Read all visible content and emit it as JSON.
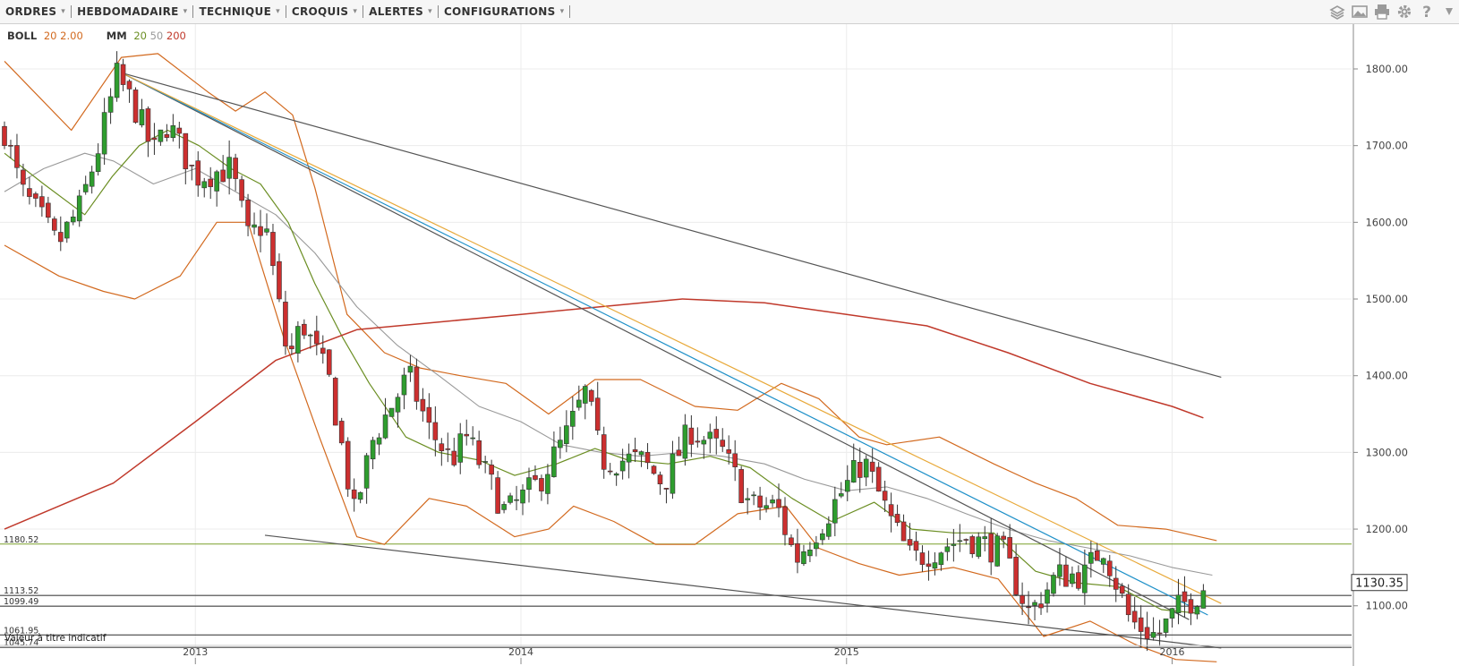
{
  "toolbar": {
    "menus": [
      {
        "label": "ORDRES"
      },
      {
        "label": "HEBDOMADAIRE"
      },
      {
        "label": "TECHNIQUE"
      },
      {
        "label": "CROQUIS"
      },
      {
        "label": "ALERTES"
      },
      {
        "label": "CONFIGURATIONS"
      }
    ],
    "tools": [
      "layers-icon",
      "image-icon",
      "print-icon",
      "gear-icon",
      "help-icon",
      "more-icon"
    ]
  },
  "legend": {
    "boll": {
      "name": "BOLL",
      "p1": "20",
      "p2": "2.00",
      "color": "#d2691e"
    },
    "mm": {
      "name": "MM",
      "p1": "20",
      "p2": "50",
      "p3": "200",
      "c1": "#6b8e23",
      "c2": "#999999",
      "c3": "#c0392b"
    }
  },
  "price_label": "1130.35",
  "footnote": "Valeur à titre indicatif",
  "level_lines": [
    {
      "value": 1180.52,
      "label": "1180.52",
      "color": "#7aa02a"
    },
    {
      "value": 1113.52,
      "label": "1113.52",
      "color": "#444444"
    },
    {
      "value": 1099.49,
      "label": "1099.49",
      "color": "#444444"
    },
    {
      "value": 1061.95,
      "label": "1061.95",
      "color": "#444444"
    },
    {
      "value": 1045.74,
      "label": "1045.74",
      "color": "#444444"
    }
  ],
  "chart_data": {
    "type": "candlestick",
    "x_axis": {
      "type": "date",
      "range": [
        "2012-06-01",
        "2016-03-10"
      ],
      "ticks": [
        {
          "date": "2013-01-01",
          "label": "2013"
        },
        {
          "date": "2014-01-01",
          "label": "2014"
        },
        {
          "date": "2015-01-01",
          "label": "2015"
        },
        {
          "date": "2016-01-01",
          "label": "2016"
        }
      ]
    },
    "y_axis": {
      "range": [
        1025,
        1835
      ],
      "ticks": [
        1100,
        1200,
        1300,
        1400,
        1500,
        1600,
        1700,
        1800
      ],
      "tick_labels": [
        "1100.00",
        "1200.00",
        "1300.00",
        "1400.00",
        "1500.00",
        "1600.00",
        "1700.00",
        "1800.00"
      ]
    },
    "grid": true,
    "up_color": "#2e9d2e",
    "down_color": "#cc2f2f",
    "close_anchors": [
      {
        "t": "2012-06-01",
        "c": 1720
      },
      {
        "t": "2012-06-20",
        "c": 1640
      },
      {
        "t": "2012-07-15",
        "c": 1600
      },
      {
        "t": "2012-07-30",
        "c": 1570
      },
      {
        "t": "2012-08-25",
        "c": 1620
      },
      {
        "t": "2012-09-15",
        "c": 1700
      },
      {
        "t": "2012-10-05",
        "c": 1790
      },
      {
        "t": "2012-10-25",
        "c": 1750
      },
      {
        "t": "2012-11-15",
        "c": 1690
      },
      {
        "t": "2012-12-01",
        "c": 1730
      },
      {
        "t": "2013-01-01",
        "c": 1660
      },
      {
        "t": "2013-02-10",
        "c": 1670
      },
      {
        "t": "2013-03-01",
        "c": 1580
      },
      {
        "t": "2013-03-20",
        "c": 1600
      },
      {
        "t": "2013-04-15",
        "c": 1420
      },
      {
        "t": "2013-05-01",
        "c": 1470
      },
      {
        "t": "2013-06-01",
        "c": 1390
      },
      {
        "t": "2013-06-28",
        "c": 1220
      },
      {
        "t": "2013-07-20",
        "c": 1320
      },
      {
        "t": "2013-08-28",
        "c": 1400
      },
      {
        "t": "2013-09-20",
        "c": 1330
      },
      {
        "t": "2013-10-15",
        "c": 1290
      },
      {
        "t": "2013-11-01",
        "c": 1320
      },
      {
        "t": "2013-12-15",
        "c": 1220
      },
      {
        "t": "2014-01-20",
        "c": 1260
      },
      {
        "t": "2014-02-20",
        "c": 1320
      },
      {
        "t": "2014-03-15",
        "c": 1380
      },
      {
        "t": "2014-04-01",
        "c": 1290
      },
      {
        "t": "2014-05-15",
        "c": 1290
      },
      {
        "t": "2014-06-10",
        "c": 1260
      },
      {
        "t": "2014-07-10",
        "c": 1330
      },
      {
        "t": "2014-08-15",
        "c": 1300
      },
      {
        "t": "2014-09-15",
        "c": 1230
      },
      {
        "t": "2014-10-15",
        "c": 1230
      },
      {
        "t": "2014-11-05",
        "c": 1160
      },
      {
        "t": "2014-12-05",
        "c": 1210
      },
      {
        "t": "2015-01-20",
        "c": 1290
      },
      {
        "t": "2015-02-20",
        "c": 1210
      },
      {
        "t": "2015-03-15",
        "c": 1160
      },
      {
        "t": "2015-05-15",
        "c": 1190
      },
      {
        "t": "2015-06-25",
        "c": 1170
      },
      {
        "t": "2015-07-25",
        "c": 1090
      },
      {
        "t": "2015-08-25",
        "c": 1140
      },
      {
        "t": "2015-09-25",
        "c": 1140
      },
      {
        "t": "2015-10-15",
        "c": 1180
      },
      {
        "t": "2015-11-15",
        "c": 1080
      },
      {
        "t": "2015-12-15",
        "c": 1060
      },
      {
        "t": "2016-01-10",
        "c": 1100
      },
      {
        "t": "2016-01-25",
        "c": 1110
      },
      {
        "t": "2016-02-05",
        "c": 1125
      }
    ],
    "bollinger": {
      "upper": [
        {
          "t": "2012-06-01",
          "v": 1810
        },
        {
          "t": "2012-08-15",
          "v": 1720
        },
        {
          "t": "2012-10-10",
          "v": 1815
        },
        {
          "t": "2012-11-20",
          "v": 1820
        },
        {
          "t": "2013-01-15",
          "v": 1770
        },
        {
          "t": "2013-02-15",
          "v": 1745
        },
        {
          "t": "2013-03-20",
          "v": 1770
        },
        {
          "t": "2013-04-20",
          "v": 1740
        },
        {
          "t": "2013-05-15",
          "v": 1645
        },
        {
          "t": "2013-06-20",
          "v": 1480
        },
        {
          "t": "2013-08-01",
          "v": 1430
        },
        {
          "t": "2013-09-10",
          "v": 1410
        },
        {
          "t": "2013-10-25",
          "v": 1400
        },
        {
          "t": "2013-12-15",
          "v": 1390
        },
        {
          "t": "2014-02-01",
          "v": 1350
        },
        {
          "t": "2014-03-25",
          "v": 1395
        },
        {
          "t": "2014-05-15",
          "v": 1395
        },
        {
          "t": "2014-07-15",
          "v": 1360
        },
        {
          "t": "2014-09-01",
          "v": 1355
        },
        {
          "t": "2014-10-20",
          "v": 1390
        },
        {
          "t": "2014-12-01",
          "v": 1370
        },
        {
          "t": "2015-01-15",
          "v": 1320
        },
        {
          "t": "2015-02-15",
          "v": 1310
        },
        {
          "t": "2015-04-15",
          "v": 1320
        },
        {
          "t": "2015-06-15",
          "v": 1285
        },
        {
          "t": "2015-08-01",
          "v": 1260
        },
        {
          "t": "2015-09-15",
          "v": 1240
        },
        {
          "t": "2015-11-01",
          "v": 1205
        },
        {
          "t": "2015-12-25",
          "v": 1200
        },
        {
          "t": "2016-02-20",
          "v": 1185
        }
      ],
      "lower": [
        {
          "t": "2012-06-01",
          "v": 1570
        },
        {
          "t": "2012-08-01",
          "v": 1530
        },
        {
          "t": "2012-09-20",
          "v": 1510
        },
        {
          "t": "2012-10-25",
          "v": 1500
        },
        {
          "t": "2012-12-15",
          "v": 1530
        },
        {
          "t": "2013-01-25",
          "v": 1600
        },
        {
          "t": "2013-03-01",
          "v": 1600
        },
        {
          "t": "2013-04-10",
          "v": 1450
        },
        {
          "t": "2013-05-20",
          "v": 1320
        },
        {
          "t": "2013-07-01",
          "v": 1190
        },
        {
          "t": "2013-08-01",
          "v": 1180
        },
        {
          "t": "2013-09-20",
          "v": 1240
        },
        {
          "t": "2013-11-01",
          "v": 1230
        },
        {
          "t": "2013-12-25",
          "v": 1190
        },
        {
          "t": "2014-02-01",
          "v": 1200
        },
        {
          "t": "2014-03-01",
          "v": 1230
        },
        {
          "t": "2014-04-15",
          "v": 1210
        },
        {
          "t": "2014-06-01",
          "v": 1180
        },
        {
          "t": "2014-07-15",
          "v": 1180
        },
        {
          "t": "2014-09-01",
          "v": 1220
        },
        {
          "t": "2014-10-25",
          "v": 1230
        },
        {
          "t": "2014-12-01",
          "v": 1175
        },
        {
          "t": "2015-01-15",
          "v": 1155
        },
        {
          "t": "2015-03-01",
          "v": 1140
        },
        {
          "t": "2015-05-01",
          "v": 1150
        },
        {
          "t": "2015-06-20",
          "v": 1135
        },
        {
          "t": "2015-08-10",
          "v": 1060
        },
        {
          "t": "2015-10-01",
          "v": 1080
        },
        {
          "t": "2015-11-20",
          "v": 1050
        },
        {
          "t": "2016-01-05",
          "v": 1030
        },
        {
          "t": "2016-02-20",
          "v": 1027
        }
      ]
    },
    "ma20": [
      {
        "t": "2012-06-01",
        "v": 1690
      },
      {
        "t": "2012-07-15",
        "v": 1650
      },
      {
        "t": "2012-08-30",
        "v": 1610
      },
      {
        "t": "2012-09-30",
        "v": 1660
      },
      {
        "t": "2012-10-30",
        "v": 1700
      },
      {
        "t": "2012-12-01",
        "v": 1720
      },
      {
        "t": "2013-01-05",
        "v": 1700
      },
      {
        "t": "2013-02-10",
        "v": 1670
      },
      {
        "t": "2013-03-15",
        "v": 1650
      },
      {
        "t": "2013-04-15",
        "v": 1600
      },
      {
        "t": "2013-05-15",
        "v": 1520
      },
      {
        "t": "2013-06-15",
        "v": 1450
      },
      {
        "t": "2013-07-15",
        "v": 1390
      },
      {
        "t": "2013-08-25",
        "v": 1320
      },
      {
        "t": "2013-10-01",
        "v": 1300
      },
      {
        "t": "2013-11-15",
        "v": 1290
      },
      {
        "t": "2013-12-25",
        "v": 1270
      },
      {
        "t": "2014-02-10",
        "v": 1285
      },
      {
        "t": "2014-03-25",
        "v": 1305
      },
      {
        "t": "2014-05-01",
        "v": 1290
      },
      {
        "t": "2014-06-15",
        "v": 1285
      },
      {
        "t": "2014-08-01",
        "v": 1295
      },
      {
        "t": "2014-09-15",
        "v": 1280
      },
      {
        "t": "2014-11-01",
        "v": 1240
      },
      {
        "t": "2014-12-15",
        "v": 1210
      },
      {
        "t": "2015-02-01",
        "v": 1235
      },
      {
        "t": "2015-03-15",
        "v": 1200
      },
      {
        "t": "2015-05-01",
        "v": 1195
      },
      {
        "t": "2015-06-15",
        "v": 1195
      },
      {
        "t": "2015-08-01",
        "v": 1145
      },
      {
        "t": "2015-09-15",
        "v": 1130
      },
      {
        "t": "2015-11-01",
        "v": 1125
      },
      {
        "t": "2015-12-20",
        "v": 1095
      },
      {
        "t": "2016-02-01",
        "v": 1090
      }
    ],
    "ma50": [
      {
        "t": "2012-06-01",
        "v": 1640
      },
      {
        "t": "2012-07-15",
        "v": 1670
      },
      {
        "t": "2012-08-30",
        "v": 1690
      },
      {
        "t": "2012-10-01",
        "v": 1680
      },
      {
        "t": "2012-11-15",
        "v": 1650
      },
      {
        "t": "2013-01-01",
        "v": 1670
      },
      {
        "t": "2013-02-15",
        "v": 1640
      },
      {
        "t": "2013-04-01",
        "v": 1610
      },
      {
        "t": "2013-05-15",
        "v": 1560
      },
      {
        "t": "2013-07-01",
        "v": 1490
      },
      {
        "t": "2013-08-15",
        "v": 1440
      },
      {
        "t": "2013-10-01",
        "v": 1400
      },
      {
        "t": "2013-11-15",
        "v": 1360
      },
      {
        "t": "2014-01-01",
        "v": 1340
      },
      {
        "t": "2014-02-15",
        "v": 1310
      },
      {
        "t": "2014-04-01",
        "v": 1300
      },
      {
        "t": "2014-05-15",
        "v": 1295
      },
      {
        "t": "2014-07-01",
        "v": 1300
      },
      {
        "t": "2014-08-15",
        "v": 1295
      },
      {
        "t": "2014-10-01",
        "v": 1285
      },
      {
        "t": "2014-11-15",
        "v": 1265
      },
      {
        "t": "2015-01-01",
        "v": 1250
      },
      {
        "t": "2015-02-15",
        "v": 1255
      },
      {
        "t": "2015-04-01",
        "v": 1240
      },
      {
        "t": "2015-05-15",
        "v": 1220
      },
      {
        "t": "2015-07-01",
        "v": 1200
      },
      {
        "t": "2015-08-15",
        "v": 1185
      },
      {
        "t": "2015-10-01",
        "v": 1175
      },
      {
        "t": "2015-11-15",
        "v": 1165
      },
      {
        "t": "2016-01-01",
        "v": 1150
      },
      {
        "t": "2016-02-15",
        "v": 1140
      }
    ],
    "ma200": [
      {
        "t": "2012-06-01",
        "v": 1200
      },
      {
        "t": "2012-10-01",
        "v": 1260
      },
      {
        "t": "2013-01-01",
        "v": 1340
      },
      {
        "t": "2013-04-01",
        "v": 1420
      },
      {
        "t": "2013-07-01",
        "v": 1460
      },
      {
        "t": "2013-10-01",
        "v": 1470
      },
      {
        "t": "2014-01-01",
        "v": 1480
      },
      {
        "t": "2014-04-01",
        "v": 1490
      },
      {
        "t": "2014-07-01",
        "v": 1500
      },
      {
        "t": "2014-10-01",
        "v": 1495
      },
      {
        "t": "2015-01-01",
        "v": 1480
      },
      {
        "t": "2015-04-01",
        "v": 1465
      },
      {
        "t": "2015-07-01",
        "v": 1430
      },
      {
        "t": "2015-10-01",
        "v": 1390
      },
      {
        "t": "2016-01-01",
        "v": 1360
      },
      {
        "t": "2016-02-05",
        "v": 1345
      }
    ],
    "trendlines": [
      {
        "name": "upper-trendline",
        "color": "#555555",
        "from": {
          "t": "2012-10-10",
          "v": 1795
        },
        "to": {
          "t": "2016-02-25",
          "v": 1398
        }
      },
      {
        "name": "support-trendline",
        "color": "#555555",
        "from": {
          "t": "2013-03-20",
          "v": 1192
        },
        "to": {
          "t": "2016-02-25",
          "v": 1045
        }
      },
      {
        "name": "black-trendline",
        "color": "#555555",
        "from": {
          "t": "2012-10-10",
          "v": 1795
        },
        "to": {
          "t": "2016-01-20",
          "v": 1082
        }
      },
      {
        "name": "blue-trendline",
        "color": "#1e90c8",
        "from": {
          "t": "2012-10-10",
          "v": 1795
        },
        "to": {
          "t": "2016-02-10",
          "v": 1088
        }
      },
      {
        "name": "yellow-trendline",
        "color": "#e8a93a",
        "from": {
          "t": "2012-10-10",
          "v": 1795
        },
        "to": {
          "t": "2016-02-25",
          "v": 1103
        }
      }
    ]
  }
}
